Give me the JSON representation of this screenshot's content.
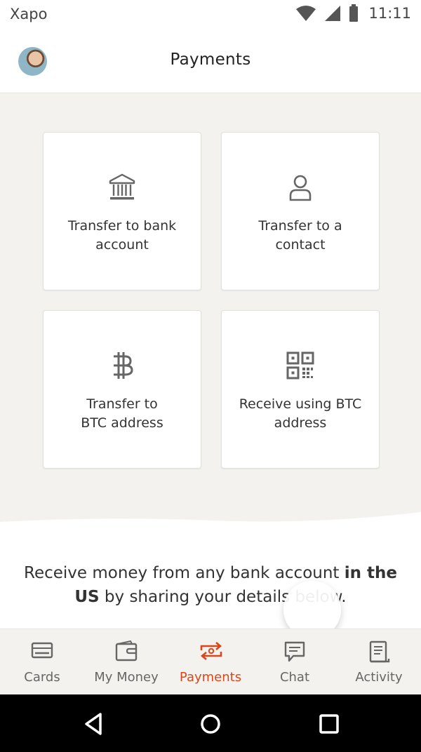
{
  "status_bar": {
    "carrier": "Xapo",
    "time": "11:11"
  },
  "header": {
    "title": "Payments"
  },
  "cards": [
    {
      "label_line1": "Transfer to bank",
      "label_line2": "account",
      "icon": "bank-icon"
    },
    {
      "label_line1": "Transfer to a",
      "label_line2": "contact",
      "icon": "person-icon"
    },
    {
      "label_line1": "Transfer to",
      "label_line2": "BTC address",
      "icon": "bitcoin-icon"
    },
    {
      "label_line1": "Receive using BTC",
      "label_line2": "address",
      "icon": "qr-code-icon"
    }
  ],
  "info": {
    "part1": "Receive money from any bank account ",
    "bold1": "in the US",
    "part2": " by sharing your details below."
  },
  "bottom_nav": [
    {
      "label": "Cards",
      "icon": "card-icon",
      "active": false
    },
    {
      "label": "My Money",
      "icon": "wallet-icon",
      "active": false
    },
    {
      "label": "Payments",
      "icon": "payments-icon",
      "active": true
    },
    {
      "label": "Chat",
      "icon": "chat-icon",
      "active": false
    },
    {
      "label": "Activity",
      "icon": "activity-icon",
      "active": false
    }
  ],
  "colors": {
    "accent": "#d9481d",
    "background": "#f3f2ee",
    "text": "#333333"
  }
}
